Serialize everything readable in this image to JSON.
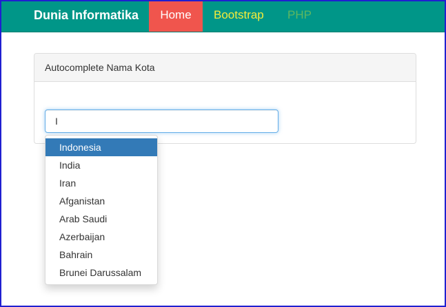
{
  "navbar": {
    "brand": "Dunia Informatika",
    "items": [
      {
        "label": "Home",
        "active": true
      },
      {
        "label": "Bootstrap"
      },
      {
        "label": "PHP"
      }
    ]
  },
  "panel": {
    "title": "Autocomplete Nama Kota"
  },
  "search": {
    "value": "I",
    "placeholder": ""
  },
  "autocomplete": {
    "selected_index": 0,
    "items": [
      "Indonesia",
      "India",
      "Iran",
      "Afganistan",
      "Arab Saudi",
      "Azerbaijan",
      "Bahrain",
      "Brunei Darussalam"
    ]
  },
  "colors": {
    "navbar_bg": "#009688",
    "home_bg": "#f0554d",
    "bootstrap_text": "#f5ec3a",
    "php_text": "#5fb760",
    "selected_item_bg": "#337ab7",
    "window_border": "#1f1fd0"
  }
}
